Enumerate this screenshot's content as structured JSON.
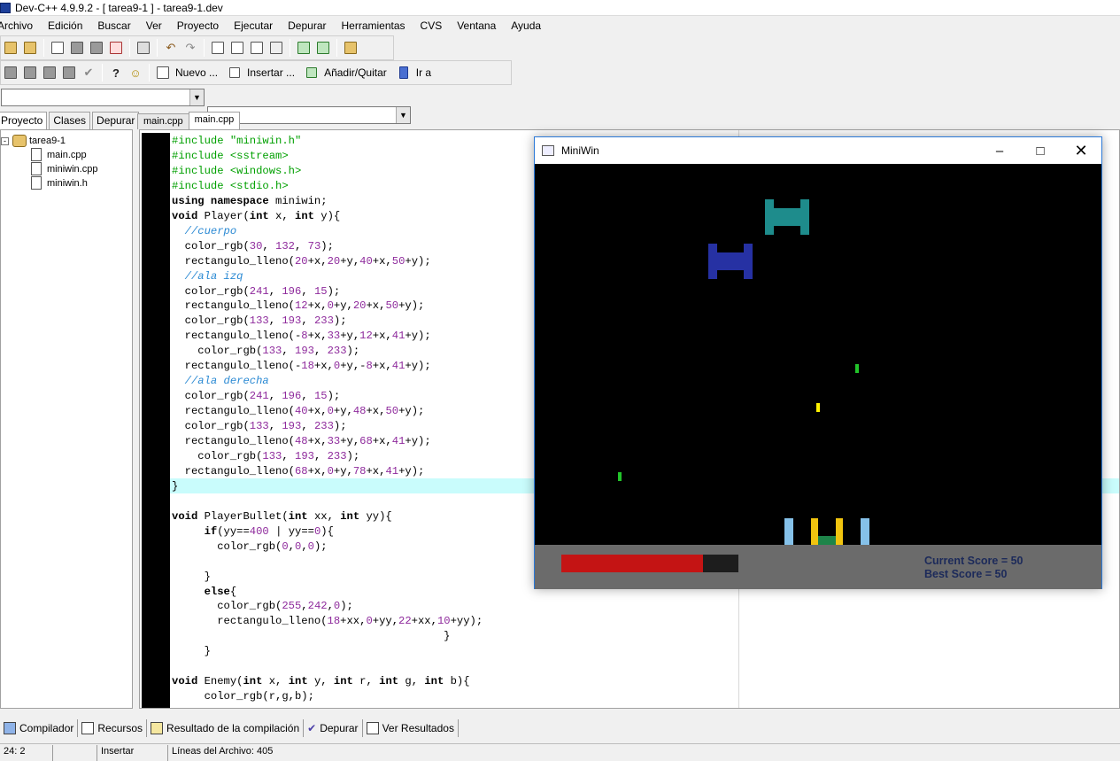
{
  "window": {
    "title": "Dev-C++ 4.9.9.2  - [ tarea9-1 ] - tarea9-1.dev"
  },
  "menu": [
    "Archivo",
    "Edición",
    "Buscar",
    "Ver",
    "Proyecto",
    "Ejecutar",
    "Depurar",
    "Herramientas",
    "CVS",
    "Ventana",
    "Ayuda"
  ],
  "toolbar2": {
    "nuevo": "Nuevo ...",
    "insertar": "Insertar ...",
    "anadir": "Añadir/Quitar",
    "ira": "Ir a"
  },
  "combos": {
    "left": "",
    "right": ""
  },
  "left_tabs": [
    "Proyecto",
    "Clases",
    "Depurar"
  ],
  "project_tree": {
    "root": "tarea9-1",
    "files": [
      "main.cpp",
      "miniwin.cpp",
      "miniwin.h"
    ]
  },
  "editor_tabs": [
    "main.cpp",
    "main.cpp"
  ],
  "bottom_tabs": [
    "Compilador",
    "Recursos",
    "Resultado de la compilación",
    "Depurar",
    "Ver Resultados"
  ],
  "status": {
    "position": "24: 2",
    "mode": "Insertar",
    "lines": "Líneas del Archivo: 405"
  },
  "miniwin": {
    "title": "MiniWin",
    "health_fraction": 0.8,
    "current_score": "Current Score = 50",
    "best_score": "Best Score = 50",
    "colors": {
      "health": "#c41414",
      "enemy_teal": "#1e8c8c",
      "enemy_blue": "#2631a3",
      "bullet_yellow": "#fff200",
      "enemy_bullet": "#22c42a",
      "player_body": "#1e8449",
      "wing": "#f1c40f",
      "wing_edge": "#85c1e9"
    }
  },
  "code": [
    "#include \"miniwin.h\"",
    "#include <sstream>",
    "#include <windows.h>",
    "#include <stdio.h>",
    "using namespace miniwin;",
    "void Player(int x, int y){",
    "  //cuerpo",
    "  color_rgb(30, 132, 73);",
    "  rectangulo_lleno(20+x,20+y,40+x,50+y);",
    "  //ala izq",
    "  color_rgb(241, 196, 15);",
    "  rectangulo_lleno(12+x,0+y,20+x,50+y);",
    "  color_rgb(133, 193, 233);",
    "  rectangulo_lleno(-8+x,33+y,12+x,41+y);",
    "    color_rgb(133, 193, 233);",
    "  rectangulo_lleno(-18+x,0+y,-8+x,41+y);",
    "  //ala derecha",
    "  color_rgb(241, 196, 15);",
    "  rectangulo_lleno(40+x,0+y,48+x,50+y);",
    "  color_rgb(133, 193, 233);",
    "  rectangulo_lleno(48+x,33+y,68+x,41+y);",
    "    color_rgb(133, 193, 233);",
    "  rectangulo_lleno(68+x,0+y,78+x,41+y);",
    "}",
    "",
    "void PlayerBullet(int xx, int yy){",
    "     if(yy==400 | yy==0){",
    "       color_rgb(0,0,0);",
    "",
    "     }",
    "     else{",
    "       color_rgb(255,242,0);",
    "       rectangulo_lleno(18+xx,0+yy,22+xx,10+yy);",
    "                                          }",
    "     }",
    "",
    "void Enemy(int x, int y, int r, int g, int b){",
    "     color_rgb(r,g,b);"
  ]
}
